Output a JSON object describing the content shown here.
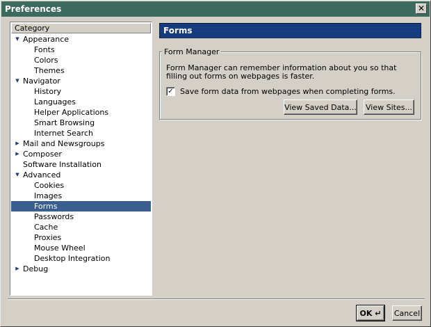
{
  "window": {
    "title": "Preferences",
    "close_glyph": "✕"
  },
  "tree": {
    "header": "Category",
    "items": [
      {
        "label": "Appearance",
        "level": 0,
        "expander": "expanded"
      },
      {
        "label": "Fonts",
        "level": 1
      },
      {
        "label": "Colors",
        "level": 1
      },
      {
        "label": "Themes",
        "level": 1
      },
      {
        "label": "Navigator",
        "level": 0,
        "expander": "expanded"
      },
      {
        "label": "History",
        "level": 1
      },
      {
        "label": "Languages",
        "level": 1
      },
      {
        "label": "Helper Applications",
        "level": 1
      },
      {
        "label": "Smart Browsing",
        "level": 1
      },
      {
        "label": "Internet Search",
        "level": 1
      },
      {
        "label": "Mail and Newsgroups",
        "level": 0,
        "expander": "collapsed"
      },
      {
        "label": "Composer",
        "level": 0,
        "expander": "collapsed"
      },
      {
        "label": "Software Installation",
        "level": 0,
        "expander": "none"
      },
      {
        "label": "Advanced",
        "level": 0,
        "expander": "expanded"
      },
      {
        "label": "Cookies",
        "level": 1
      },
      {
        "label": "Images",
        "level": 1
      },
      {
        "label": "Forms",
        "level": 1,
        "selected": true
      },
      {
        "label": "Passwords",
        "level": 1
      },
      {
        "label": "Cache",
        "level": 1
      },
      {
        "label": "Proxies",
        "level": 1
      },
      {
        "label": "Mouse Wheel",
        "level": 1
      },
      {
        "label": "Desktop Integration",
        "level": 1
      },
      {
        "label": "Debug",
        "level": 0,
        "expander": "collapsed"
      }
    ]
  },
  "panel": {
    "title": "Forms",
    "group": {
      "legend": "Form Manager",
      "description": "Form Manager can remember information about you so that filling out forms on webpages is faster.",
      "checkbox": {
        "label": "Save form data from webpages when completing forms.",
        "checked": true
      },
      "view_saved_label": "View Saved Data...",
      "view_sites_label": "View Sites..."
    }
  },
  "footer": {
    "ok_label": "OK",
    "ok_glyph": "↵",
    "cancel_label": "Cancel"
  },
  "colors": {
    "titlebar": "#3d6a5f",
    "selection": "#3a5e8e",
    "panel_header": "#1d4a93",
    "face": "#d4d0c8"
  }
}
